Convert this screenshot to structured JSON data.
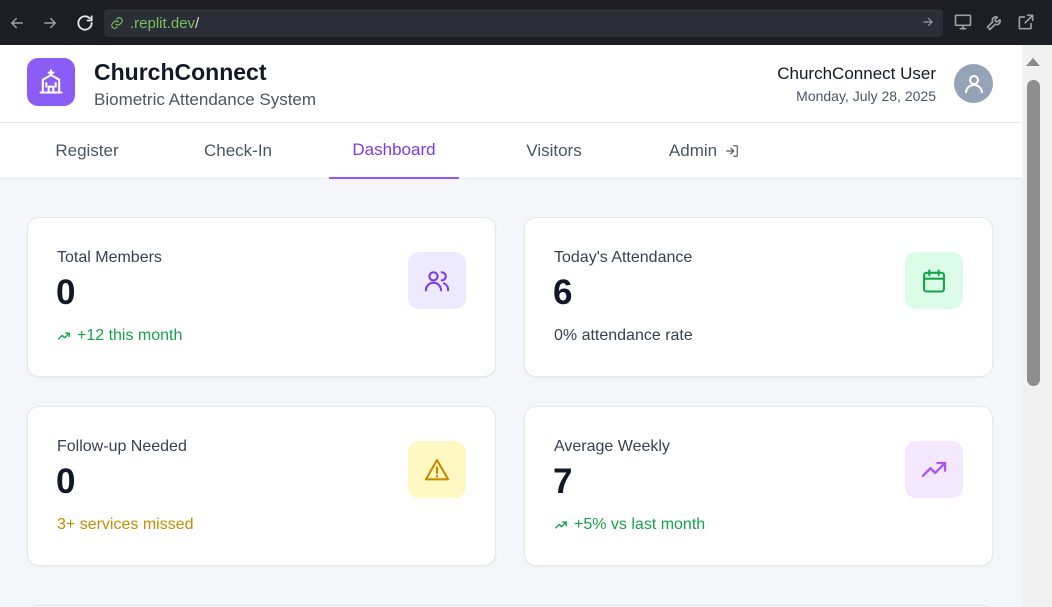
{
  "browser": {
    "url_host": ".replit.dev",
    "url_path": "/"
  },
  "header": {
    "title": "ChurchConnect",
    "subtitle": "Biometric Attendance System",
    "user_name": "ChurchConnect User",
    "date": "Monday, July 28, 2025"
  },
  "tabs": [
    {
      "label": "Register"
    },
    {
      "label": "Check-In"
    },
    {
      "label": "Dashboard"
    },
    {
      "label": "Visitors"
    },
    {
      "label": "Admin"
    }
  ],
  "active_tab": "Dashboard",
  "cards": [
    {
      "label": "Total Members",
      "value": "0",
      "sub": "+12 this month",
      "icon": "users-icon",
      "sub_color": "#16a34a",
      "icon_bg": "#ede9fe",
      "icon_color": "#7c3aed"
    },
    {
      "label": "Today's Attendance",
      "value": "6",
      "sub": "0% attendance rate",
      "icon": "calendar-icon",
      "sub_color": "#374151",
      "icon_bg": "#dcfce7",
      "icon_color": "#16a34a"
    },
    {
      "label": "Follow-up Needed",
      "value": "0",
      "sub": "3+ services missed",
      "icon": "warning-icon",
      "sub_color": "#ca8a04",
      "icon_bg": "#fef9c3",
      "icon_color": "#ca8a04"
    },
    {
      "label": "Average Weekly",
      "value": "7",
      "sub": "+5% vs last month",
      "icon": "trending-up-icon",
      "sub_color": "#16a34a",
      "icon_bg": "#f3e8ff",
      "icon_color": "#a855f7"
    }
  ],
  "colors": {
    "brand": "#8b5cf6",
    "active_tab": "#7c3aed"
  }
}
